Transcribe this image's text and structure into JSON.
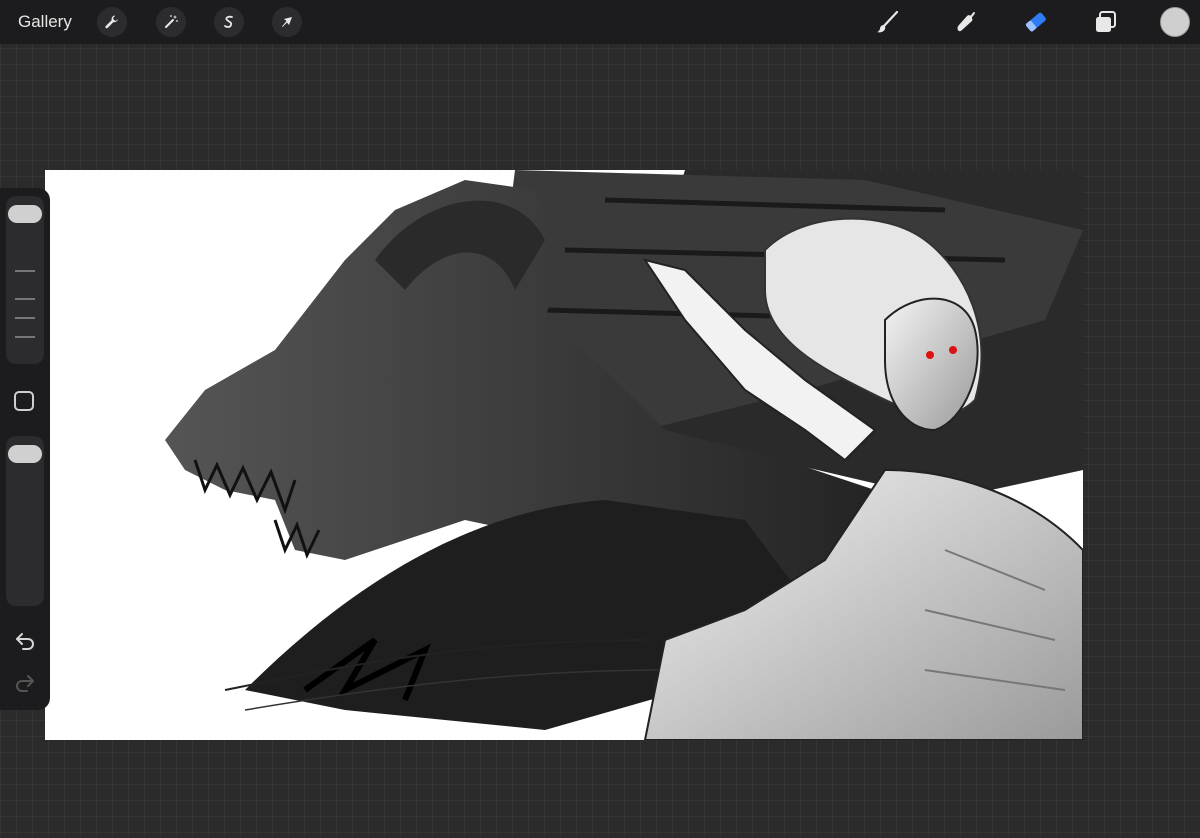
{
  "topbar": {
    "gallery_label": "Gallery",
    "left_tools": [
      "wrench-icon",
      "magic-wand-icon",
      "selection-icon",
      "transform-arrow-icon"
    ],
    "right_tools": [
      "brush-icon",
      "smudge-icon",
      "eraser-icon",
      "layers-icon"
    ],
    "active_tool": "eraser-icon",
    "active_color": "#cfcfcf",
    "accent": "#2f7cf6"
  },
  "sidebar": {
    "brush_size_level": 0.95,
    "opacity_level": 0.95,
    "icons": [
      "modify-square-icon",
      "undo-icon",
      "redo-icon"
    ]
  },
  "canvas": {
    "background": "#ffffff",
    "content": "artwork"
  }
}
